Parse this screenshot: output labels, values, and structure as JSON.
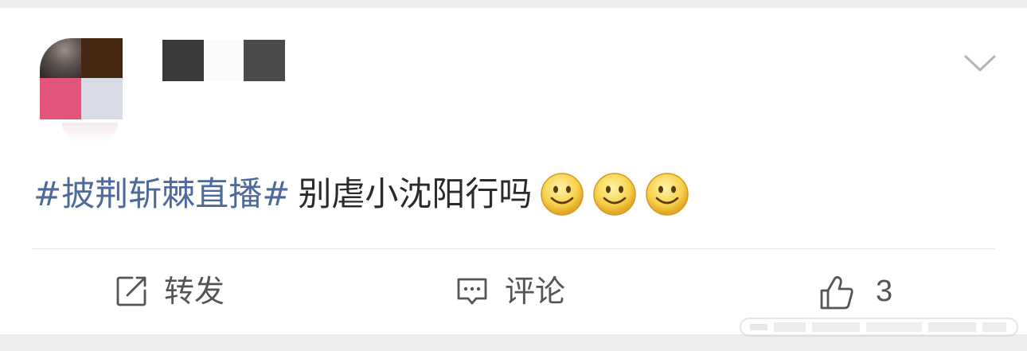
{
  "post": {
    "author": {
      "avatar": "pixelated-avatar",
      "name_masked": true
    },
    "topic": "#披荆斩棘直播#",
    "text": "别虐小沈阳行吗",
    "emojis": [
      "smile-emoji",
      "smile-emoji",
      "smile-emoji"
    ],
    "menu_icon": "chevron-down-icon"
  },
  "actions": {
    "repost": {
      "icon": "repost-icon",
      "label": "转发"
    },
    "comment": {
      "icon": "comment-icon",
      "label": "评论"
    },
    "like": {
      "icon": "thumbs-up-icon",
      "count": "3"
    }
  },
  "colors": {
    "topic_link": "#4d6a9a",
    "text": "#2a2a2a",
    "action_text": "#555555",
    "background": "#ffffff",
    "page_gap": "#ededed"
  }
}
